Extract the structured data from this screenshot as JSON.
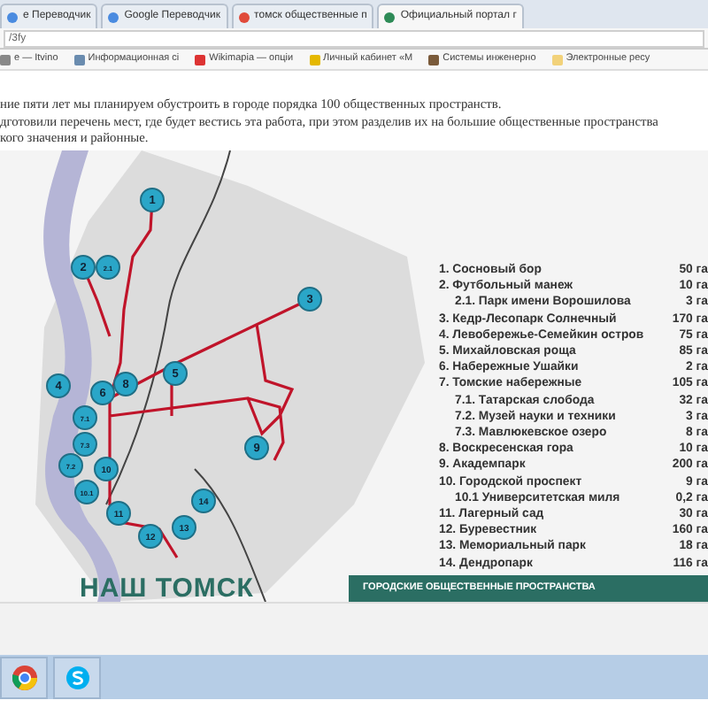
{
  "browser": {
    "tabs": [
      {
        "title": "е Переводчик",
        "selected": false
      },
      {
        "title": "Google Переводчик",
        "selected": false
      },
      {
        "title": "томск общественные п",
        "selected": false
      },
      {
        "title": "Официальный портал г",
        "selected": true
      }
    ],
    "address": "/3fy",
    "bookmarks": [
      "е — Itvino",
      "Информационная сі",
      "Wikimapia — опціи",
      "Личный кабинет «М",
      "Системы инженерно",
      "Электронные ресу"
    ]
  },
  "article": {
    "lines": [
      "ние пяти лет мы планируем обустроить в городе порядка 100 общественных пространств.",
      "дготовили перечень мест, где будет вестись эта работа, при этом разделив их на большие общественные пространства",
      "кого значения и районные."
    ]
  },
  "map": {
    "markers": [
      "1",
      "2",
      "2.1",
      "3",
      "4",
      "5",
      "6",
      "8",
      "7.1",
      "7.3",
      "7.2",
      "10",
      "10.1",
      "11",
      "12",
      "13",
      "14",
      "9"
    ],
    "legend": [
      {
        "kind": "main",
        "name": "1. Сосновый бор",
        "area": "50 га"
      },
      {
        "kind": "main",
        "name": "2. Футбольный манеж",
        "area": "10 га"
      },
      {
        "kind": "sub",
        "name": "2.1. Парк имени Ворошилова",
        "area": "3 га"
      },
      {
        "kind": "main",
        "name": "3. Кедр-Лесопарк Солнечный",
        "area": "170 га"
      },
      {
        "kind": "main",
        "name": "4. Левобережье-Семейкин остров",
        "area": "75 га"
      },
      {
        "kind": "main",
        "name": "5. Михайловская роща",
        "area": "85 га"
      },
      {
        "kind": "main",
        "name": "6. Набережные Ушайки",
        "area": "2 га"
      },
      {
        "kind": "main",
        "name": "7. Томские набережные",
        "area": "105 га"
      },
      {
        "kind": "sub",
        "name": "7.1. Татарская слобода",
        "area": "32 га"
      },
      {
        "kind": "sub",
        "name": "7.2. Музей науки и техники",
        "area": "3 га"
      },
      {
        "kind": "sub",
        "name": "7.3. Мавлюкевское озеро",
        "area": "8 га"
      },
      {
        "kind": "main",
        "name": "8. Воскресенская гора",
        "area": "10 га"
      },
      {
        "kind": "main",
        "name": "9. Академпарк",
        "area": "200 га"
      },
      {
        "kind": "main",
        "name": "10. Городской проспект",
        "area": "9 га"
      },
      {
        "kind": "sub",
        "name": "10.1 Университетская миля",
        "area": "0,2 га"
      },
      {
        "kind": "main",
        "name": "11. Лагерный сад",
        "area": "30 га"
      },
      {
        "kind": "main",
        "name": "12. Буревестник",
        "area": "160 га"
      },
      {
        "kind": "main",
        "name": "13. Мемориальный парк",
        "area": "18 га"
      },
      {
        "kind": "main",
        "name": "14. Дендропарк",
        "area": "116 га"
      }
    ],
    "logo": "НАШ ТОМСК",
    "banner": "ГОРОДСКИЕ ОБЩЕСТВЕННЫЕ ПРОСТРАНСТВА"
  }
}
